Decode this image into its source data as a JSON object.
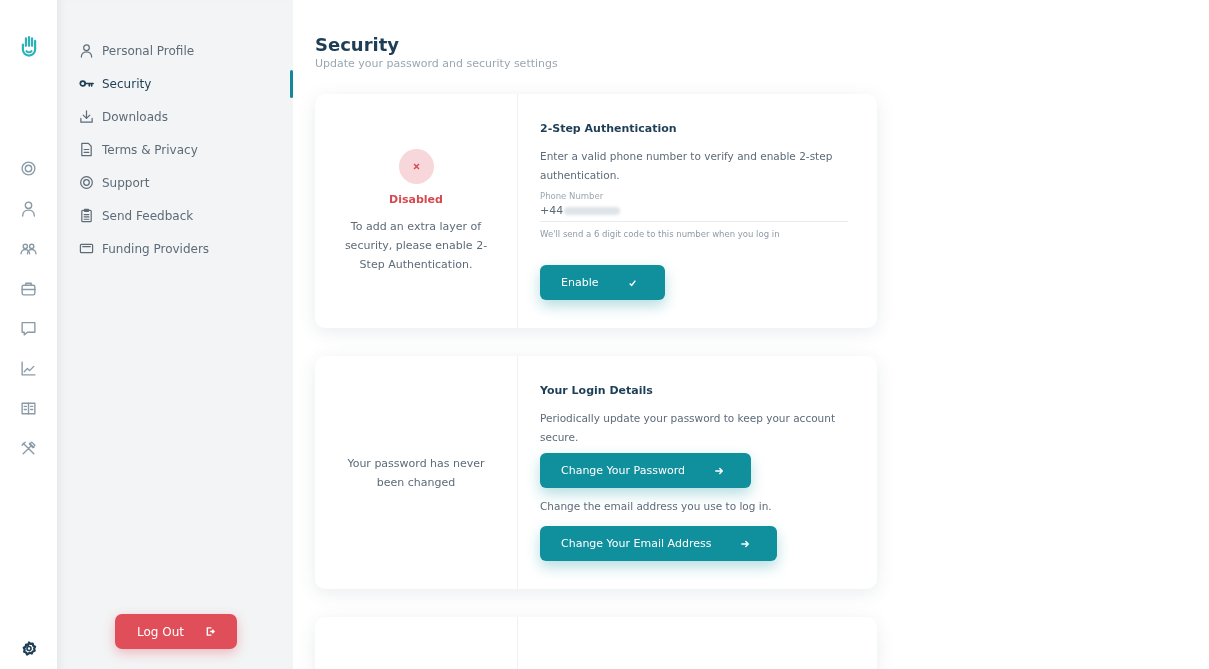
{
  "settings_menu": [
    {
      "label": "Personal Profile",
      "selected": false
    },
    {
      "label": "Security",
      "selected": true
    },
    {
      "label": "Downloads",
      "selected": false
    },
    {
      "label": "Terms & Privacy",
      "selected": false
    },
    {
      "label": "Support",
      "selected": false
    },
    {
      "label": "Send Feedback",
      "selected": false
    },
    {
      "label": "Funding Providers",
      "selected": false
    }
  ],
  "logout_button": "Log Out",
  "page": {
    "title": "Security",
    "subtitle": "Update your password and security settings"
  },
  "two_step": {
    "enabled": false,
    "status": "Disabled",
    "status_note": "To add an extra layer of security, please enable 2-Step Authentication.",
    "heading": "2-Step Authentication",
    "description": "Enter a valid phone number to verify and enable 2-step authentication.",
    "phone_label": "Phone Number",
    "phone_value": "+44",
    "phone_hint": "We'll send a 6 digit code to this number when you log in",
    "button": "Enable"
  },
  "login_details": {
    "note": "Your password has never been changed",
    "heading": "Your Login Details",
    "password_text": "Periodically update your password to keep your account secure.",
    "password_button": "Change Your Password",
    "email_text": "Change the email address you use to log in.",
    "email_button": "Change Your Email Address"
  }
}
